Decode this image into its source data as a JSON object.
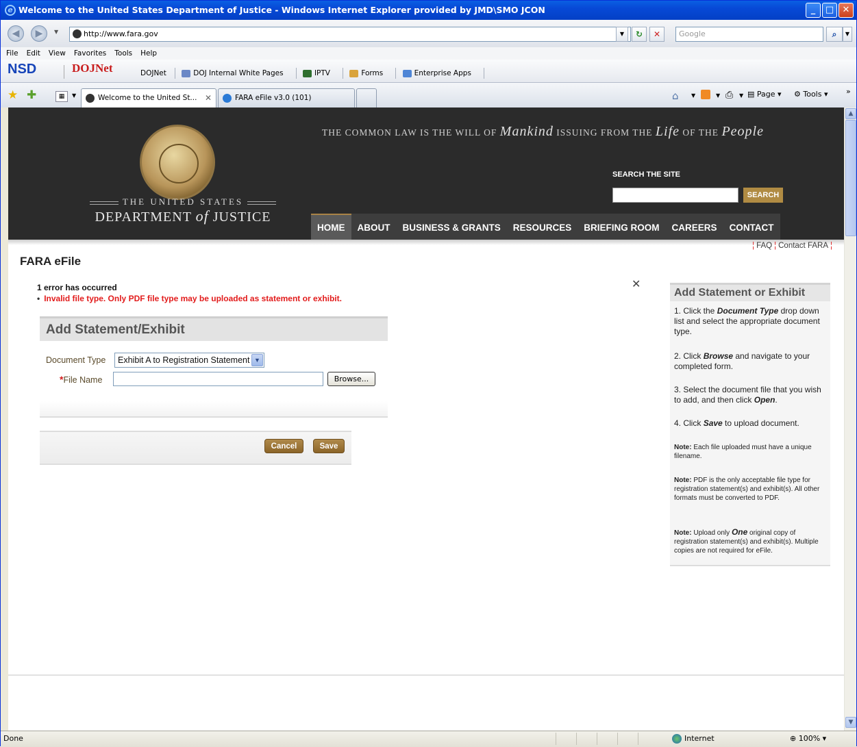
{
  "window": {
    "title": "Welcome to the United States Department of Justice - Windows Internet Explorer provided by JMD\\SMO JCON"
  },
  "address_bar": {
    "url": "http://www.fara.gov",
    "search_placeholder": "Google"
  },
  "menu": [
    "File",
    "Edit",
    "View",
    "Favorites",
    "Tools",
    "Help"
  ],
  "favorites_bar": {
    "logo1": "NSD",
    "logo2": "DOJNet",
    "links": [
      "DOJNet",
      "DOJ Internal White Pages",
      "IPTV",
      "Forms",
      "Enterprise Apps"
    ]
  },
  "tabs": [
    {
      "label": "Welcome to the United St...",
      "active": true
    },
    {
      "label": "FARA eFile v3.0 (101)",
      "active": false
    }
  ],
  "command_bar": {
    "page": "Page",
    "tools": "Tools"
  },
  "doj_header": {
    "name_line1": "THE UNITED STATES",
    "name_line2_a": "DEPARTMENT",
    "name_line2_of": "of",
    "name_line2_b": "JUSTICE",
    "motto_1": "THE COMMON LAW IS THE WILL OF",
    "motto_mankind": "Mankind",
    "motto_2": "ISSUING FROM THE",
    "motto_life": "Life",
    "motto_3": "OF THE",
    "motto_people": "People",
    "search_label": "SEARCH THE SITE",
    "search_button": "SEARCH",
    "nav": [
      "HOME",
      "ABOUT",
      "BUSINESS & GRANTS",
      "RESOURCES",
      "BRIEFING ROOM",
      "CAREERS",
      "CONTACT"
    ]
  },
  "links": {
    "faq": "FAQ",
    "contact": "Contact FARA"
  },
  "page_title": "FARA eFile",
  "errors": {
    "summary": "1 error has occurred",
    "message": "Invalid file type. Only PDF file type may be uploaded as statement or exhibit."
  },
  "form": {
    "heading": "Add Statement/Exhibit",
    "doc_type_label": "Document Type",
    "doc_type_value": "Exhibit A to Registration Statement",
    "file_name_label": "File Name",
    "required_mark": "*",
    "browse_label": "Browse...",
    "cancel_label": "Cancel",
    "save_label": "Save"
  },
  "help": {
    "heading": "Add Statement or Exhibit",
    "step1_a": "1. Click the ",
    "step1_b": "Document Type",
    "step1_c": " drop down list and select the appropriate document type.",
    "step2_a": "2. Click ",
    "step2_b": "Browse",
    "step2_c": " and navigate to your completed form.",
    "step3_a": "3. Select the document file that you wish to add, and then click ",
    "step3_b": "Open",
    "step3_c": ".",
    "step4_a": "4. Click ",
    "step4_b": "Save",
    "step4_c": " to upload document.",
    "note_label": "Note:",
    "note1": " Each file uploaded must have a unique filename.",
    "note2": " PDF is the only acceptable file type for registration statement(s) and exhibit(s). All other formats must be converted to PDF.",
    "note3_a": " Upload only ",
    "note3_b": "One",
    "note3_c": " original copy of registration statement(s) and exhibit(s). Multiple copies are not required for eFile."
  },
  "status_bar": {
    "status": "Done",
    "zone": "Internet",
    "zoom": "100%"
  }
}
